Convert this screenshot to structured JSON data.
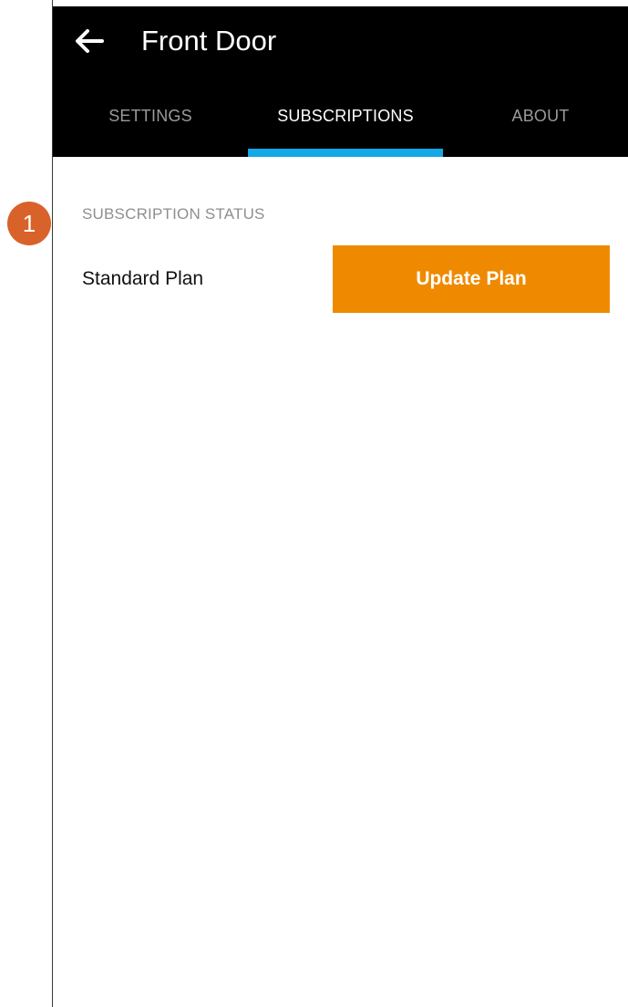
{
  "header": {
    "title": "Front Door",
    "back_icon": "arrow-left-icon",
    "background": "#000000"
  },
  "tabs": [
    {
      "label": "SETTINGS",
      "active": false
    },
    {
      "label": "SUBSCRIPTIONS",
      "active": true
    },
    {
      "label": "ABOUT",
      "active": false
    }
  ],
  "subscription": {
    "section_label": "SUBSCRIPTION STATUS",
    "plan_name": "Standard Plan",
    "update_button_label": "Update Plan"
  },
  "annotation": {
    "step_number": "1"
  },
  "colors": {
    "accent_tab_indicator": "#14a8e6",
    "update_button": "#ef8a00",
    "step_badge": "#d8622a"
  }
}
